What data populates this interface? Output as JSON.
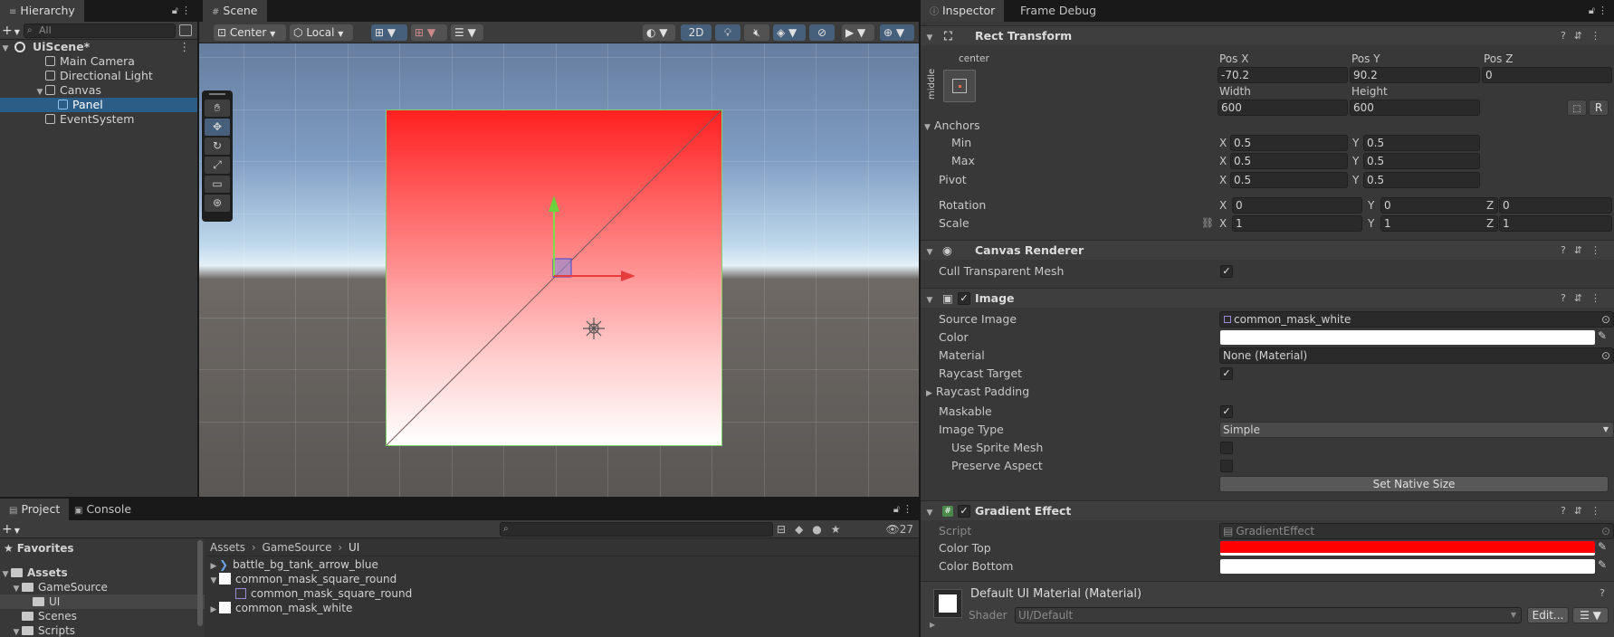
{
  "hierarchy": {
    "tab": "Hierarchy",
    "search_placeholder": "All",
    "items": [
      {
        "label": "UiScene*"
      },
      {
        "label": "Main Camera"
      },
      {
        "label": "Directional Light"
      },
      {
        "label": "Canvas"
      },
      {
        "label": "Panel"
      },
      {
        "label": "EventSystem"
      }
    ]
  },
  "scene": {
    "tab": "Scene",
    "pivot_mode": "Center",
    "pivot_rotation": "Local",
    "mode_2d": "2D"
  },
  "project": {
    "tabs": [
      "Project",
      "Console"
    ],
    "hidden_count": "27",
    "favorites_label": "Favorites",
    "tree": [
      {
        "label": "Assets"
      },
      {
        "label": "GameSource"
      },
      {
        "label": "UI"
      },
      {
        "label": "Scenes"
      },
      {
        "label": "Scripts"
      }
    ],
    "breadcrumb": [
      "Assets",
      "GameSource",
      "UI"
    ],
    "assets": [
      {
        "label": "battle_bg_tank_arrow_blue"
      },
      {
        "label": "common_mask_square_round"
      },
      {
        "label": "common_mask_square_round"
      },
      {
        "label": "common_mask_white"
      }
    ]
  },
  "inspector": {
    "tabs": [
      "Inspector",
      "Frame Debug"
    ],
    "rect_transform": {
      "title": "Rect Transform",
      "anchor_h": "center",
      "anchor_v": "middle",
      "pos_x_label": "Pos X",
      "pos_x": "-70.2",
      "pos_y_label": "Pos Y",
      "pos_y": "90.2",
      "pos_z_label": "Pos Z",
      "pos_z": "0",
      "width_label": "Width",
      "width": "600",
      "height_label": "Height",
      "height": "600",
      "r_button": "R",
      "anchors_label": "Anchors",
      "min_label": "Min",
      "min_x": "0.5",
      "min_y": "0.5",
      "max_label": "Max",
      "max_x": "0.5",
      "max_y": "0.5",
      "pivot_label": "Pivot",
      "pivot_x": "0.5",
      "pivot_y": "0.5",
      "rotation_label": "Rotation",
      "rot_x": "0",
      "rot_y": "0",
      "rot_z": "0",
      "scale_label": "Scale",
      "scale_x": "1",
      "scale_y": "1",
      "scale_z": "1",
      "x": "X",
      "y": "Y",
      "z": "Z"
    },
    "canvas_renderer": {
      "title": "Canvas Renderer",
      "cull_label": "Cull Transparent Mesh"
    },
    "image": {
      "title": "Image",
      "source_image_label": "Source Image",
      "source_image": "common_mask_white",
      "color_label": "Color",
      "material_label": "Material",
      "material": "None (Material)",
      "raycast_target_label": "Raycast Target",
      "raycast_padding_label": "Raycast Padding",
      "maskable_label": "Maskable",
      "image_type_label": "Image Type",
      "image_type": "Simple",
      "use_sprite_mesh_label": "Use Sprite Mesh",
      "preserve_aspect_label": "Preserve Aspect",
      "native_size_button": "Set Native Size"
    },
    "gradient_effect": {
      "title": "Gradient Effect",
      "script_label": "Script",
      "script": "GradientEffect",
      "color_top_label": "Color Top",
      "color_top": "#ff0000",
      "color_bottom_label": "Color Bottom",
      "color_bottom": "#ffffff"
    },
    "material": {
      "title": "Default UI Material (Material)",
      "shader_label": "Shader",
      "shader": "UI/Default",
      "edit_button": "Edit..."
    }
  }
}
